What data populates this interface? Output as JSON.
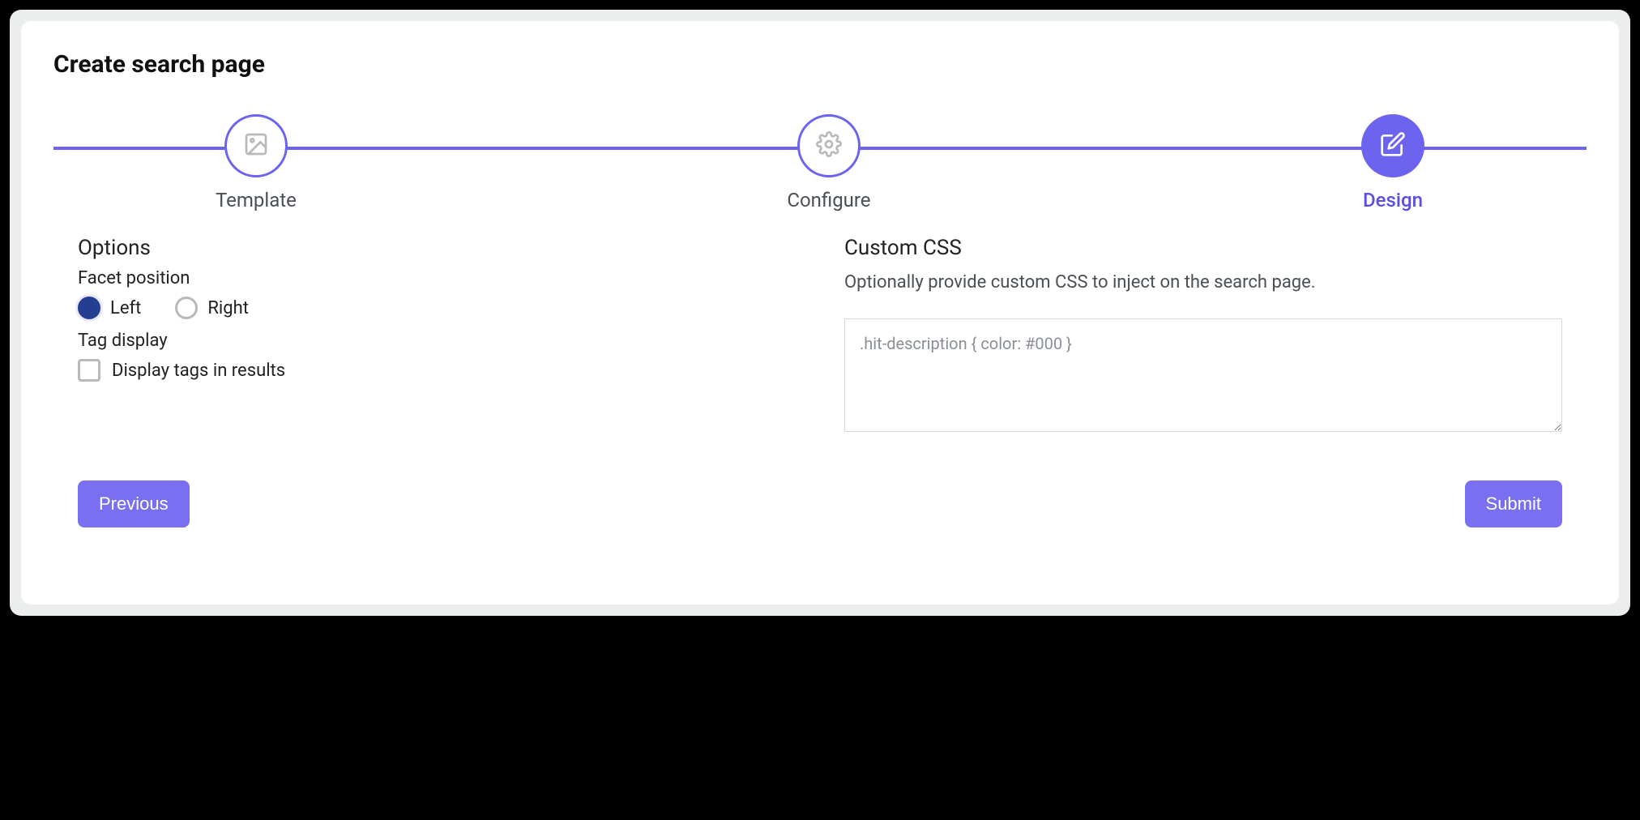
{
  "title": "Create search page",
  "stepper": {
    "steps": [
      {
        "label": "Template",
        "icon": "image-icon",
        "active": false
      },
      {
        "label": "Configure",
        "icon": "gear-icon",
        "active": false
      },
      {
        "label": "Design",
        "icon": "edit-icon",
        "active": true
      }
    ]
  },
  "options": {
    "heading": "Options",
    "facet_position_label": "Facet position",
    "facet_position_options": [
      "Left",
      "Right"
    ],
    "facet_position_selected": "Left",
    "tag_display_label": "Tag display",
    "tag_checkbox_label": "Display tags in results",
    "tag_checkbox_checked": false
  },
  "custom_css": {
    "heading": "Custom CSS",
    "hint": "Optionally provide custom CSS to inject on the search page.",
    "placeholder": ".hit-description { color: #000 }",
    "value": ""
  },
  "footer": {
    "previous_label": "Previous",
    "submit_label": "Submit"
  }
}
